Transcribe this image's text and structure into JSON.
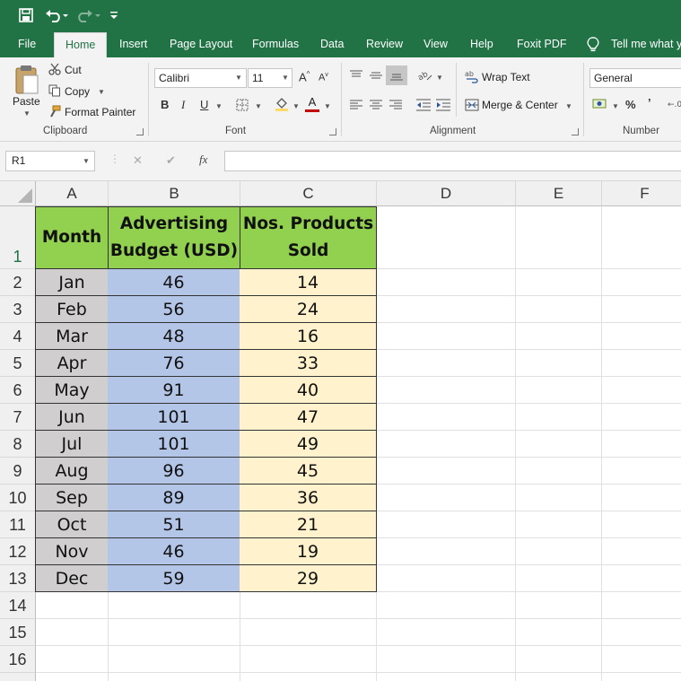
{
  "quick_access": {
    "icons": [
      "save-icon",
      "undo-icon",
      "redo-icon",
      "customize-qat-icon"
    ]
  },
  "tabs": [
    {
      "label": "File"
    },
    {
      "label": "Home"
    },
    {
      "label": "Insert"
    },
    {
      "label": "Page Layout"
    },
    {
      "label": "Formulas"
    },
    {
      "label": "Data"
    },
    {
      "label": "Review"
    },
    {
      "label": "View"
    },
    {
      "label": "Help"
    },
    {
      "label": "Foxit PDF"
    },
    {
      "label": "Tell me what yo"
    }
  ],
  "ribbon": {
    "clipboard": {
      "paste": "Paste",
      "cut": "Cut",
      "copy": "Copy",
      "format_painter": "Format Painter",
      "label": "Clipboard"
    },
    "font": {
      "font_name": "Calibri",
      "font_size": "11",
      "grow": "A",
      "shrink": "A",
      "bold": "B",
      "italic": "I",
      "underline": "U",
      "color_letter": "A",
      "label": "Font"
    },
    "alignment": {
      "wrap_text": "Wrap Text",
      "merge_center": "Merge & Center",
      "label": "Alignment"
    },
    "number": {
      "format": "General",
      "percent": "%",
      "comma": "’",
      "label": "Number"
    },
    "accent_color": "#217346"
  },
  "formula_bar": {
    "name_box": "R1",
    "cancel": "✕",
    "enter": "✔",
    "fx": "fx",
    "value": ""
  },
  "sheet": {
    "columns": [
      "A",
      "B",
      "C",
      "D",
      "E",
      "F"
    ],
    "rows": [
      "1",
      "2",
      "3",
      "4",
      "5",
      "6",
      "7",
      "8",
      "9",
      "10",
      "11",
      "12",
      "13",
      "14",
      "15",
      "16"
    ],
    "header": {
      "month": "Month",
      "budget_line1": "Advertising",
      "budget_line2": "Budget (USD)",
      "sold_line1": "Nos. Products",
      "sold_line2": "Sold"
    },
    "data": [
      {
        "month": "Jan",
        "budget": "46",
        "sold": "14"
      },
      {
        "month": "Feb",
        "budget": "56",
        "sold": "24"
      },
      {
        "month": "Mar",
        "budget": "48",
        "sold": "16"
      },
      {
        "month": "Apr",
        "budget": "76",
        "sold": "33"
      },
      {
        "month": "May",
        "budget": "91",
        "sold": "40"
      },
      {
        "month": "Jun",
        "budget": "101",
        "sold": "47"
      },
      {
        "month": "Jul",
        "budget": "101",
        "sold": "49"
      },
      {
        "month": "Aug",
        "budget": "96",
        "sold": "45"
      },
      {
        "month": "Sep",
        "budget": "89",
        "sold": "36"
      },
      {
        "month": "Oct",
        "budget": "51",
        "sold": "21"
      },
      {
        "month": "Nov",
        "budget": "46",
        "sold": "19"
      },
      {
        "month": "Dec",
        "budget": "59",
        "sold": "29"
      }
    ],
    "colors": {
      "header_fill": "#92d050",
      "month_fill": "#d0cece",
      "budget_fill": "#b4c6e7",
      "sold_fill": "#fff2cc"
    }
  }
}
